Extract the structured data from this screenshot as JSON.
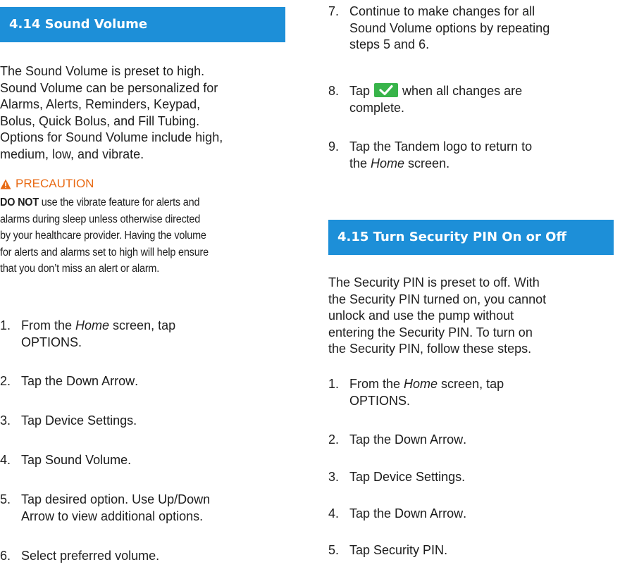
{
  "left": {
    "section_title": "4.14 Sound Volume",
    "intro_lines": [
      "The Sound Volume is preset to high.",
      "Sound Volume can be personalized for",
      "Alarms, Alerts, Reminders, Keypad,",
      "Bolus, Quick Bolus, and Fill Tubing.",
      "Options for Sound Volume include high,",
      "medium, low, and vibrate."
    ],
    "precaution": {
      "heading": "PRECAUTION",
      "lead": "DO NOT",
      "line1": " use the vibrate feature for alerts and",
      "lines": [
        "alarms during sleep unless otherwise directed",
        "by your healthcare provider. Having the volume",
        "for alerts and alarms set to high will help ensure",
        "that you don’t miss an alert or alarm."
      ]
    },
    "steps": [
      {
        "num": "1.",
        "a": "From the ",
        "b": "Home",
        "c": " screen, tap",
        "d": "OPTIONS",
        "e": "."
      },
      {
        "num": "2.",
        "a": "Tap the ",
        "b": "Down Arrow",
        "c": "."
      },
      {
        "num": "3.",
        "a": "Tap ",
        "b": "Device Settings",
        "c": "."
      },
      {
        "num": "4.",
        "a": "Tap ",
        "b": "Sound Volume",
        "c": "."
      },
      {
        "num": "5.",
        "a": "Tap desired option. Use ",
        "b": "Up/Down",
        "c": "Arrow",
        "d": " to view additional options."
      },
      {
        "num": "6.",
        "a": "Select preferred volume."
      }
    ]
  },
  "right": {
    "steps_top": [
      {
        "num": "7.",
        "lines": [
          "Continue to make changes for all",
          "Sound Volume options by repeating",
          "steps 5 and 6."
        ]
      },
      {
        "num": "8.",
        "a": "Tap",
        "b": "when all changes are",
        "c": "complete."
      },
      {
        "num": "9.",
        "a": "Tap the ",
        "b": "Tandem logo",
        "c": " to return to",
        "d": "the ",
        "e": "Home",
        "f": " screen."
      }
    ],
    "section_title": "4.15 Turn Security PIN On or Off",
    "intro_lines": [
      "The Security PIN is preset to off. With",
      "the Security PIN turned on, you cannot",
      "unlock and use the pump without",
      "entering the Security PIN. To turn on",
      "the Security PIN, follow these steps."
    ],
    "steps": [
      {
        "num": "1.",
        "a": "From the ",
        "b": "Home",
        "c": " screen, tap",
        "d": "OPTIONS",
        "e": "."
      },
      {
        "num": "2.",
        "a": "Tap the ",
        "b": "Down Arrow",
        "c": "."
      },
      {
        "num": "3.",
        "a": "Tap ",
        "b": "Device Settings",
        "c": "."
      },
      {
        "num": "4.",
        "a": "Tap the ",
        "b": "Down Arrow",
        "c": "."
      },
      {
        "num": "5.",
        "a": "Tap ",
        "b": "Security PIN",
        "c": "."
      }
    ]
  },
  "colors": {
    "banner": "#1d8fd8",
    "precaution": "#e86a14",
    "check_button": "#38b44a"
  },
  "icons": [
    "warning-triangle-icon",
    "checkmark-icon"
  ]
}
